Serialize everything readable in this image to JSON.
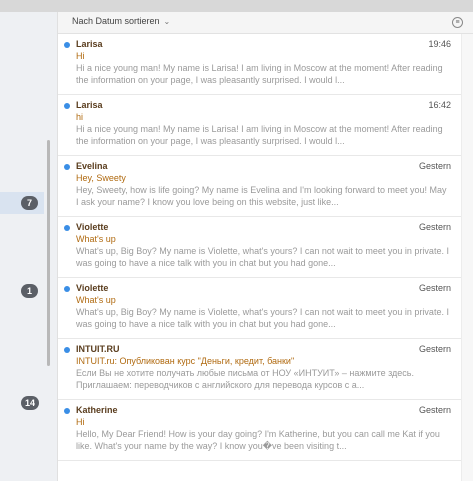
{
  "header": {
    "sort_label": "Nach Datum sortieren",
    "chevron_glyph": "⌄",
    "filter_glyph": "≡"
  },
  "sidebar": {
    "badges": [
      "7",
      "1",
      "14"
    ]
  },
  "messages": [
    {
      "sender": "Larisa",
      "time": "19:46",
      "subject": "Hi",
      "preview": "Hi a nice young man! My name is Larisa! I am living in Moscow at the moment! After reading the information on your page, I was pleasantly surprised. I would l..."
    },
    {
      "sender": "Larisa",
      "time": "16:42",
      "subject": "hi",
      "preview": "Hi a nice young man! My name is Larisa! I am living in Moscow at the moment! After reading the information on your page, I was pleasantly surprised. I would l..."
    },
    {
      "sender": "Evelina",
      "time": "Gestern",
      "subject": "Hey, Sweety",
      "preview": "Hey, Sweety, how is life going? My name is Evelina and I'm looking forward to meet you! May I ask your name? I know you love being on this website, just like..."
    },
    {
      "sender": "Violette",
      "time": "Gestern",
      "subject": "What's up",
      "preview": "What's up, Big Boy? My name is Violette, what's yours? I can not wait to meet you in private. I was going to have a nice talk with you in chat but you had gone..."
    },
    {
      "sender": "Violette",
      "time": "Gestern",
      "subject": "What's up",
      "preview": "What's up, Big Boy? My name is Violette, what's yours? I can not wait to meet you in private. I was going to have a nice talk with you in chat but you had gone..."
    },
    {
      "sender": "INTUIT.RU",
      "time": "Gestern",
      "subject": "INTUIT.ru: Опубликован курс \"Деньги, кредит, банки\"",
      "preview": "Если Вы не хотите получать любые письма от НОУ «ИНТУИТ» – нажмите здесь. Приглашаем: переводчиков с английского для перевода курсов с а..."
    },
    {
      "sender": "Katherine",
      "time": "Gestern",
      "subject": "Hi",
      "preview": "Hello, My Dear Friend! How is your day going? I'm Katherine, but you can call me Kat if you like. What's your name by the way? I know you�ve been visiting t..."
    }
  ]
}
